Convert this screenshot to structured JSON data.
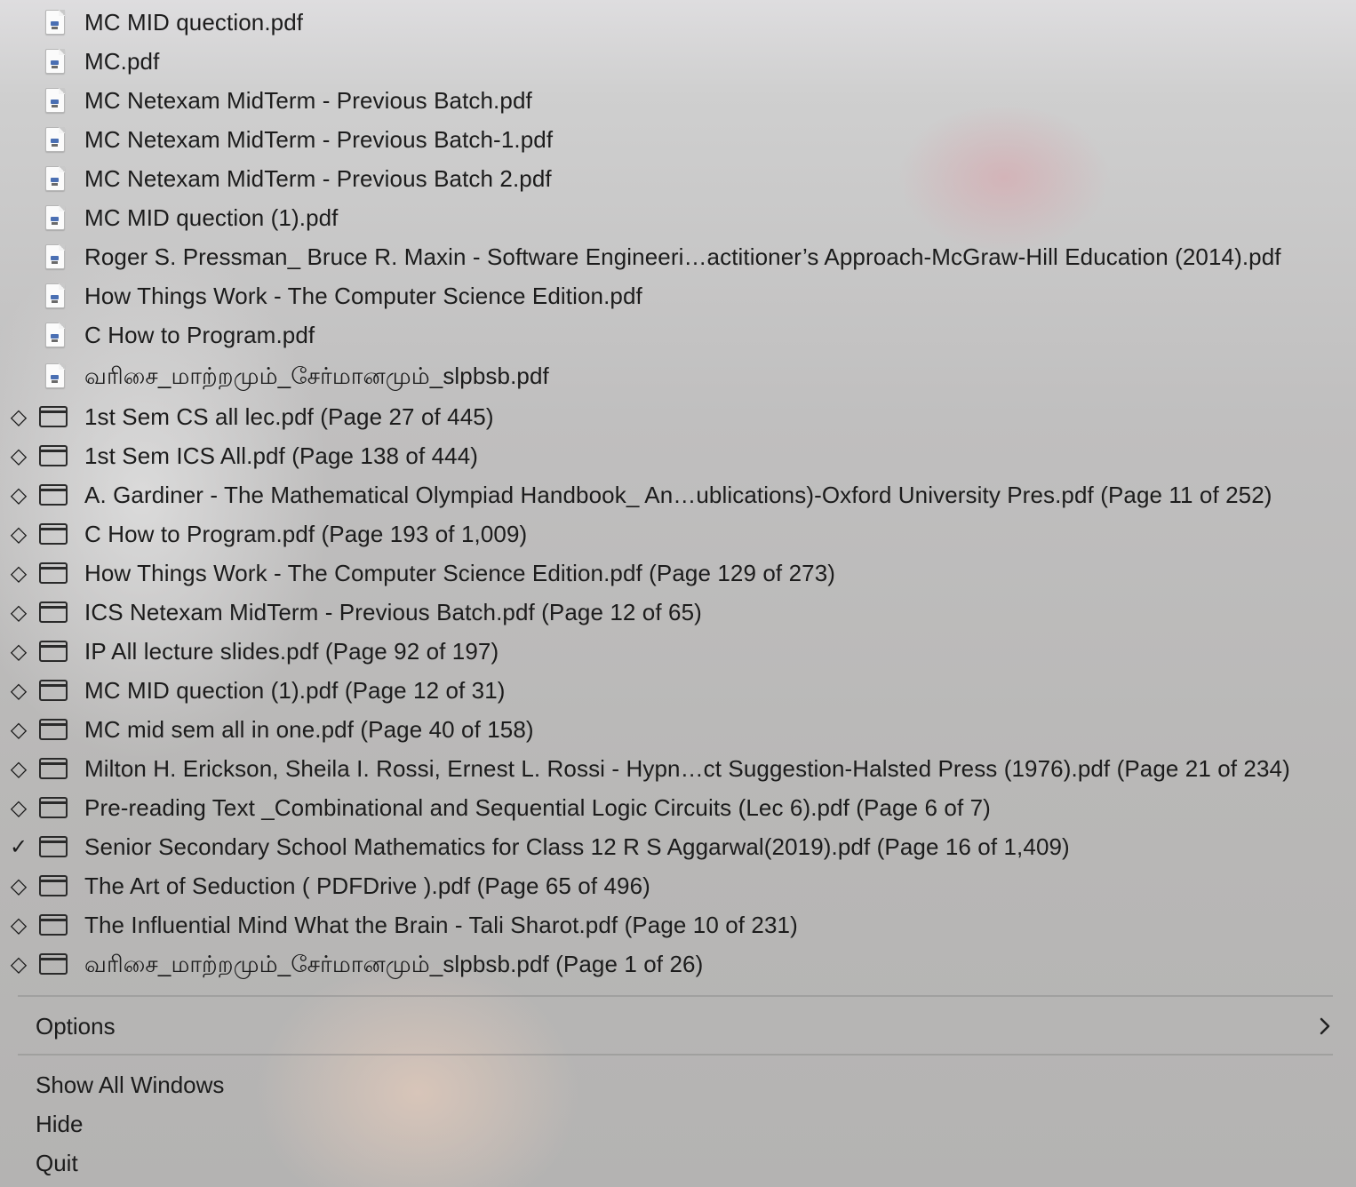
{
  "recent_files": [
    {
      "label": "MC MID quection.pdf"
    },
    {
      "label": "MC.pdf"
    },
    {
      "label": "MC Netexam MidTerm - Previous Batch.pdf"
    },
    {
      "label": "MC Netexam MidTerm - Previous Batch-1.pdf"
    },
    {
      "label": "MC Netexam MidTerm - Previous Batch 2.pdf"
    },
    {
      "label": "MC MID quection (1).pdf"
    },
    {
      "label": "Roger S. Pressman_ Bruce R. Maxin - Software Engineeri…actitioner’s Approach-McGraw-Hill Education (2014).pdf"
    },
    {
      "label": "How Things Work - The Computer Science Edition.pdf"
    },
    {
      "label": "C How to Program.pdf"
    },
    {
      "label": "வரிசை_மாற்றமும்_சேர்மானமும்_slpbsb.pdf"
    }
  ],
  "windows": [
    {
      "label": "1st Sem CS all lec.pdf (Page 27 of 445)",
      "mark": "◇"
    },
    {
      "label": "1st Sem ICS All.pdf (Page 138 of 444)",
      "mark": "◇"
    },
    {
      "label": "A. Gardiner - The Mathematical Olympiad Handbook_ An…ublications)-Oxford University Pres.pdf (Page 11 of 252)",
      "mark": "◇"
    },
    {
      "label": "C How to Program.pdf (Page 193 of 1,009)",
      "mark": "◇"
    },
    {
      "label": "How Things Work - The Computer Science Edition.pdf (Page 129 of 273)",
      "mark": "◇"
    },
    {
      "label": "ICS Netexam MidTerm - Previous Batch.pdf (Page 12 of 65)",
      "mark": "◇"
    },
    {
      "label": "IP All lecture slides.pdf (Page 92 of 197)",
      "mark": "◇"
    },
    {
      "label": "MC MID quection (1).pdf (Page 12 of 31)",
      "mark": "◇"
    },
    {
      "label": "MC mid sem all in one.pdf (Page 40 of 158)",
      "mark": "◇"
    },
    {
      "label": "Milton H. Erickson, Sheila I. Rossi, Ernest L. Rossi - Hypn…ct Suggestion-Halsted Press (1976).pdf (Page 21 of 234)",
      "mark": "◇"
    },
    {
      "label": "Pre-reading Text _Combinational and Sequential Logic Circuits (Lec 6).pdf (Page 6 of 7)",
      "mark": "◇"
    },
    {
      "label": "Senior Secondary School Mathematics for Class 12 R S Aggarwal(2019).pdf (Page 16 of 1,409)",
      "mark": "✓"
    },
    {
      "label": "The Art of Seduction ( PDFDrive ).pdf (Page 65 of 496)",
      "mark": "◇"
    },
    {
      "label": "The Influential Mind What the Brain - Tali Sharot.pdf (Page 10 of 231)",
      "mark": "◇"
    },
    {
      "label": "வரிசை_மாற்றமும்_சேர்மானமும்_slpbsb.pdf (Page 1 of 26)",
      "mark": "◇"
    }
  ],
  "options": {
    "label": "Options"
  },
  "commands": {
    "show_all_windows": "Show All Windows",
    "hide": "Hide",
    "quit": "Quit"
  },
  "icons": {
    "file": "pdf-document-icon",
    "window": "window-icon",
    "submenu": "chevron-right-icon",
    "minimized": "diamond-icon",
    "active": "checkmark-icon"
  }
}
